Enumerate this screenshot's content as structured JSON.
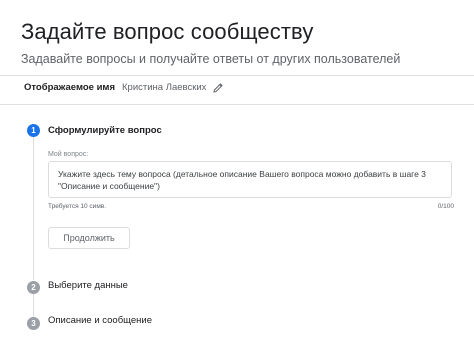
{
  "header": {
    "title": "Задайте вопрос сообществу",
    "subtitle": "Задавайте вопросы и получайте ответы от других пользователей"
  },
  "display_name": {
    "label": "Отображаемое имя",
    "value": "Кристина Лаевских",
    "edit_icon": "pencil-icon"
  },
  "steps": [
    {
      "number": "1",
      "title": "Сформулируйте вопрос",
      "state": "active"
    },
    {
      "number": "2",
      "title": "Выберите данные",
      "state": "inactive"
    },
    {
      "number": "3",
      "title": "Описание и сообщение",
      "state": "inactive"
    }
  ],
  "question_form": {
    "field_label": "Мой вопрос:",
    "placeholder": "Укажите здесь тему вопроса (детальное описание Вашего вопроса можно добавить в шаге 3 \"Описание и сообщение\")",
    "value": "",
    "helper_text": "Требуется 10 симв.",
    "counter": "0/100",
    "continue_label": "Продолжить"
  },
  "colors": {
    "accent": "#1a73e8",
    "inactive_step": "#9aa0a6",
    "text_primary": "#202124",
    "text_secondary": "#5f6368",
    "border": "#dadce0"
  }
}
